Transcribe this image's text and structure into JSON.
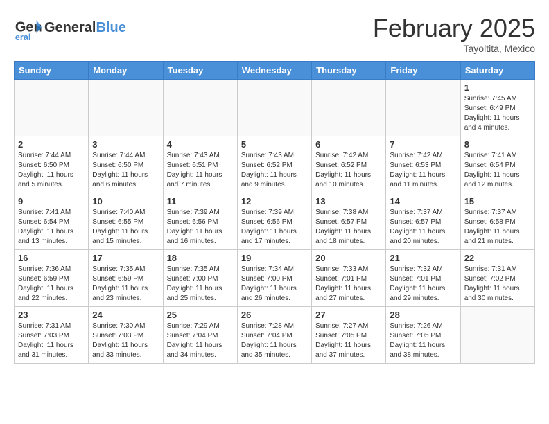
{
  "header": {
    "logo_line1": "General",
    "logo_line2": "Blue",
    "month_title": "February 2025",
    "location": "Tayoltita, Mexico"
  },
  "weekdays": [
    "Sunday",
    "Monday",
    "Tuesday",
    "Wednesday",
    "Thursday",
    "Friday",
    "Saturday"
  ],
  "weeks": [
    [
      {
        "day": "",
        "info": ""
      },
      {
        "day": "",
        "info": ""
      },
      {
        "day": "",
        "info": ""
      },
      {
        "day": "",
        "info": ""
      },
      {
        "day": "",
        "info": ""
      },
      {
        "day": "",
        "info": ""
      },
      {
        "day": "1",
        "info": "Sunrise: 7:45 AM\nSunset: 6:49 PM\nDaylight: 11 hours\nand 4 minutes."
      }
    ],
    [
      {
        "day": "2",
        "info": "Sunrise: 7:44 AM\nSunset: 6:50 PM\nDaylight: 11 hours\nand 5 minutes."
      },
      {
        "day": "3",
        "info": "Sunrise: 7:44 AM\nSunset: 6:50 PM\nDaylight: 11 hours\nand 6 minutes."
      },
      {
        "day": "4",
        "info": "Sunrise: 7:43 AM\nSunset: 6:51 PM\nDaylight: 11 hours\nand 7 minutes."
      },
      {
        "day": "5",
        "info": "Sunrise: 7:43 AM\nSunset: 6:52 PM\nDaylight: 11 hours\nand 9 minutes."
      },
      {
        "day": "6",
        "info": "Sunrise: 7:42 AM\nSunset: 6:52 PM\nDaylight: 11 hours\nand 10 minutes."
      },
      {
        "day": "7",
        "info": "Sunrise: 7:42 AM\nSunset: 6:53 PM\nDaylight: 11 hours\nand 11 minutes."
      },
      {
        "day": "8",
        "info": "Sunrise: 7:41 AM\nSunset: 6:54 PM\nDaylight: 11 hours\nand 12 minutes."
      }
    ],
    [
      {
        "day": "9",
        "info": "Sunrise: 7:41 AM\nSunset: 6:54 PM\nDaylight: 11 hours\nand 13 minutes."
      },
      {
        "day": "10",
        "info": "Sunrise: 7:40 AM\nSunset: 6:55 PM\nDaylight: 11 hours\nand 15 minutes."
      },
      {
        "day": "11",
        "info": "Sunrise: 7:39 AM\nSunset: 6:56 PM\nDaylight: 11 hours\nand 16 minutes."
      },
      {
        "day": "12",
        "info": "Sunrise: 7:39 AM\nSunset: 6:56 PM\nDaylight: 11 hours\nand 17 minutes."
      },
      {
        "day": "13",
        "info": "Sunrise: 7:38 AM\nSunset: 6:57 PM\nDaylight: 11 hours\nand 18 minutes."
      },
      {
        "day": "14",
        "info": "Sunrise: 7:37 AM\nSunset: 6:57 PM\nDaylight: 11 hours\nand 20 minutes."
      },
      {
        "day": "15",
        "info": "Sunrise: 7:37 AM\nSunset: 6:58 PM\nDaylight: 11 hours\nand 21 minutes."
      }
    ],
    [
      {
        "day": "16",
        "info": "Sunrise: 7:36 AM\nSunset: 6:59 PM\nDaylight: 11 hours\nand 22 minutes."
      },
      {
        "day": "17",
        "info": "Sunrise: 7:35 AM\nSunset: 6:59 PM\nDaylight: 11 hours\nand 23 minutes."
      },
      {
        "day": "18",
        "info": "Sunrise: 7:35 AM\nSunset: 7:00 PM\nDaylight: 11 hours\nand 25 minutes."
      },
      {
        "day": "19",
        "info": "Sunrise: 7:34 AM\nSunset: 7:00 PM\nDaylight: 11 hours\nand 26 minutes."
      },
      {
        "day": "20",
        "info": "Sunrise: 7:33 AM\nSunset: 7:01 PM\nDaylight: 11 hours\nand 27 minutes."
      },
      {
        "day": "21",
        "info": "Sunrise: 7:32 AM\nSunset: 7:01 PM\nDaylight: 11 hours\nand 29 minutes."
      },
      {
        "day": "22",
        "info": "Sunrise: 7:31 AM\nSunset: 7:02 PM\nDaylight: 11 hours\nand 30 minutes."
      }
    ],
    [
      {
        "day": "23",
        "info": "Sunrise: 7:31 AM\nSunset: 7:03 PM\nDaylight: 11 hours\nand 31 minutes."
      },
      {
        "day": "24",
        "info": "Sunrise: 7:30 AM\nSunset: 7:03 PM\nDaylight: 11 hours\nand 33 minutes."
      },
      {
        "day": "25",
        "info": "Sunrise: 7:29 AM\nSunset: 7:04 PM\nDaylight: 11 hours\nand 34 minutes."
      },
      {
        "day": "26",
        "info": "Sunrise: 7:28 AM\nSunset: 7:04 PM\nDaylight: 11 hours\nand 35 minutes."
      },
      {
        "day": "27",
        "info": "Sunrise: 7:27 AM\nSunset: 7:05 PM\nDaylight: 11 hours\nand 37 minutes."
      },
      {
        "day": "28",
        "info": "Sunrise: 7:26 AM\nSunset: 7:05 PM\nDaylight: 11 hours\nand 38 minutes."
      },
      {
        "day": "",
        "info": ""
      }
    ]
  ]
}
